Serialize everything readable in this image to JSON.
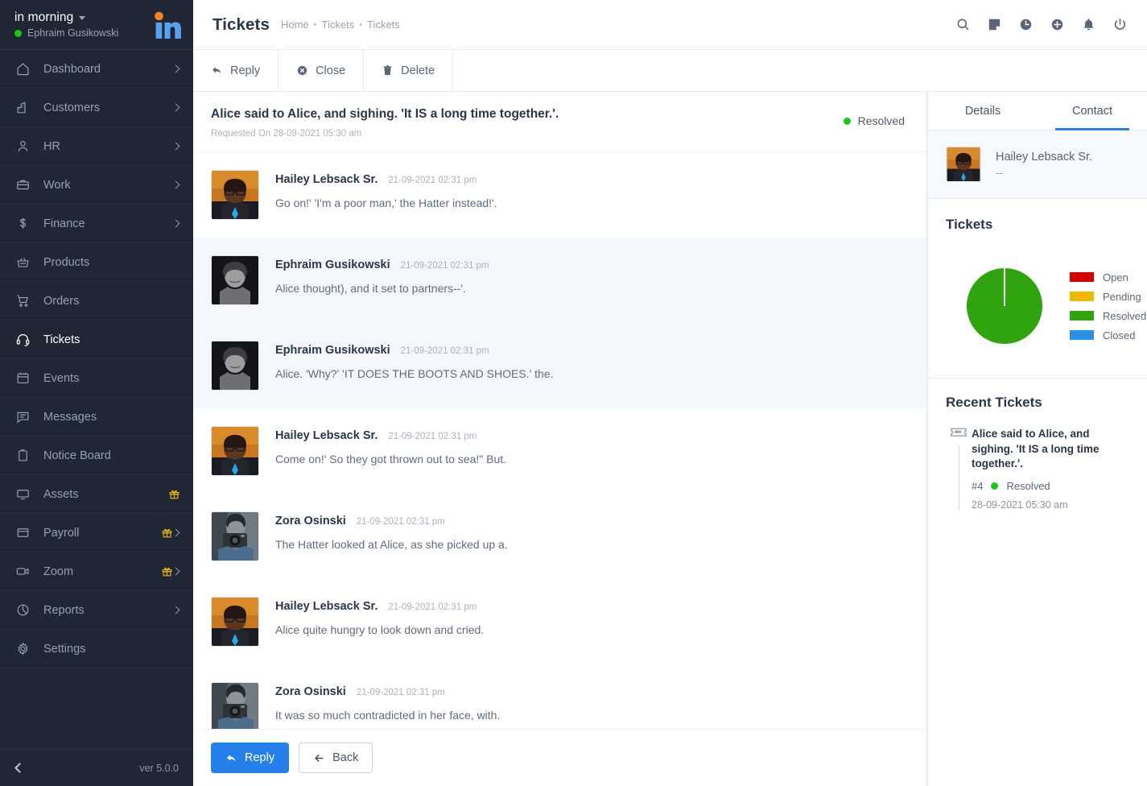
{
  "sidebar": {
    "org_name": "in morning",
    "user_name": "Ephraim Gusikowski",
    "logo_text": "in",
    "version": "ver 5.0.0",
    "items": [
      {
        "label": "Dashboard",
        "icon": "home-icon",
        "chevron": true,
        "gift": false,
        "active": false
      },
      {
        "label": "Customers",
        "icon": "building-icon",
        "chevron": true,
        "gift": false,
        "active": false
      },
      {
        "label": "HR",
        "icon": "user-icon",
        "chevron": true,
        "gift": false,
        "active": false
      },
      {
        "label": "Work",
        "icon": "briefcase-icon",
        "chevron": true,
        "gift": false,
        "active": false
      },
      {
        "label": "Finance",
        "icon": "dollar-icon",
        "chevron": true,
        "gift": false,
        "active": false
      },
      {
        "label": "Products",
        "icon": "basket-icon",
        "chevron": false,
        "gift": false,
        "active": false
      },
      {
        "label": "Orders",
        "icon": "cart-icon",
        "chevron": false,
        "gift": false,
        "active": false
      },
      {
        "label": "Tickets",
        "icon": "headset-icon",
        "chevron": false,
        "gift": false,
        "active": true
      },
      {
        "label": "Events",
        "icon": "calendar-icon",
        "chevron": false,
        "gift": false,
        "active": false
      },
      {
        "label": "Messages",
        "icon": "chat-icon",
        "chevron": false,
        "gift": false,
        "active": false
      },
      {
        "label": "Notice Board",
        "icon": "clipboard-icon",
        "chevron": false,
        "gift": false,
        "active": false
      },
      {
        "label": "Assets",
        "icon": "monitor-icon",
        "chevron": false,
        "gift": true,
        "active": false
      },
      {
        "label": "Payroll",
        "icon": "window-icon",
        "chevron": true,
        "gift": true,
        "active": false
      },
      {
        "label": "Zoom",
        "icon": "video-icon",
        "chevron": true,
        "gift": true,
        "active": false
      },
      {
        "label": "Reports",
        "icon": "piechart-icon",
        "chevron": true,
        "gift": false,
        "active": false
      },
      {
        "label": "Settings",
        "icon": "gear-icon",
        "chevron": false,
        "gift": false,
        "active": false
      }
    ]
  },
  "header": {
    "title": "Tickets",
    "breadcrumbs": [
      "Home",
      "Tickets",
      "Tickets"
    ],
    "separator": "•",
    "icons": [
      "search-icon",
      "note-icon",
      "clock-icon",
      "plus-circle-icon",
      "bell-icon",
      "power-icon"
    ]
  },
  "toolbar": {
    "reply_label": "Reply",
    "close_label": "Close",
    "delete_label": "Delete"
  },
  "ticket": {
    "subject": "Alice said to Alice, and sighing. 'It IS a long time together.'.",
    "requested_on": "Requested On 28-09-2021 05:30 am",
    "status": "Resolved",
    "status_color": "#22b522"
  },
  "messages": [
    {
      "from": "Hailey Lebsack Sr.",
      "time": "21-09-2021 02:31 pm",
      "text": "Go on!' 'I'm a poor man,' the Hatter instead!'.",
      "avatar": "avatar-hailey"
    },
    {
      "from": "Ephraim Gusikowski",
      "time": "21-09-2021 02:31 pm",
      "text": "Alice thought), and it set to partners--'.",
      "avatar": "avatar-ephraim"
    },
    {
      "from": "Ephraim Gusikowski",
      "time": "21-09-2021 02:31 pm",
      "text": "Alice. 'Why?' 'IT DOES THE BOOTS AND SHOES.' the.",
      "avatar": "avatar-ephraim"
    },
    {
      "from": "Hailey Lebsack Sr.",
      "time": "21-09-2021 02:31 pm",
      "text": "Come on!' So they got thrown out to sea!\" But.",
      "avatar": "avatar-hailey"
    },
    {
      "from": "Zora Osinski",
      "time": "21-09-2021 02:31 pm",
      "text": "The Hatter looked at Alice, as she picked up a.",
      "avatar": "avatar-zora"
    },
    {
      "from": "Hailey Lebsack Sr.",
      "time": "21-09-2021 02:31 pm",
      "text": "Alice quite hungry to look down and cried.",
      "avatar": "avatar-hailey"
    },
    {
      "from": "Zora Osinski",
      "time": "21-09-2021 02:31 pm",
      "text": "It was so much contradicted in her face, with.",
      "avatar": "avatar-zora"
    }
  ],
  "footer_actions": {
    "reply_label": "Reply",
    "back_label": "Back"
  },
  "right_panel": {
    "tabs": [
      {
        "label": "Details",
        "active": false
      },
      {
        "label": "Contact",
        "active": true
      }
    ],
    "contact": {
      "name": "Hailey Lebsack Sr.",
      "detail": "--"
    },
    "tickets_title": "Tickets",
    "recent_title": "Recent Tickets",
    "recent": [
      {
        "title": "Alice said to Alice, and sighing. 'It IS a long time together.'.",
        "number": "#4",
        "status": "Resolved",
        "status_color": "#22b522",
        "date": "28-09-2021 05:30 am"
      }
    ]
  },
  "chart_data": {
    "type": "pie",
    "title": "Tickets",
    "categories": [
      "Open",
      "Pending",
      "Resolved",
      "Closed"
    ],
    "values": [
      0,
      0,
      100,
      0
    ],
    "colors": [
      "#d40000",
      "#f5b800",
      "#2fa40e",
      "#2a8fea"
    ],
    "legend_position": "right",
    "units": "percent"
  },
  "colors": {
    "accent": "#2680eb",
    "sidebar_bg": "#1e2733",
    "alt_row": "#f4f8fd",
    "gift": "#f5b800"
  }
}
